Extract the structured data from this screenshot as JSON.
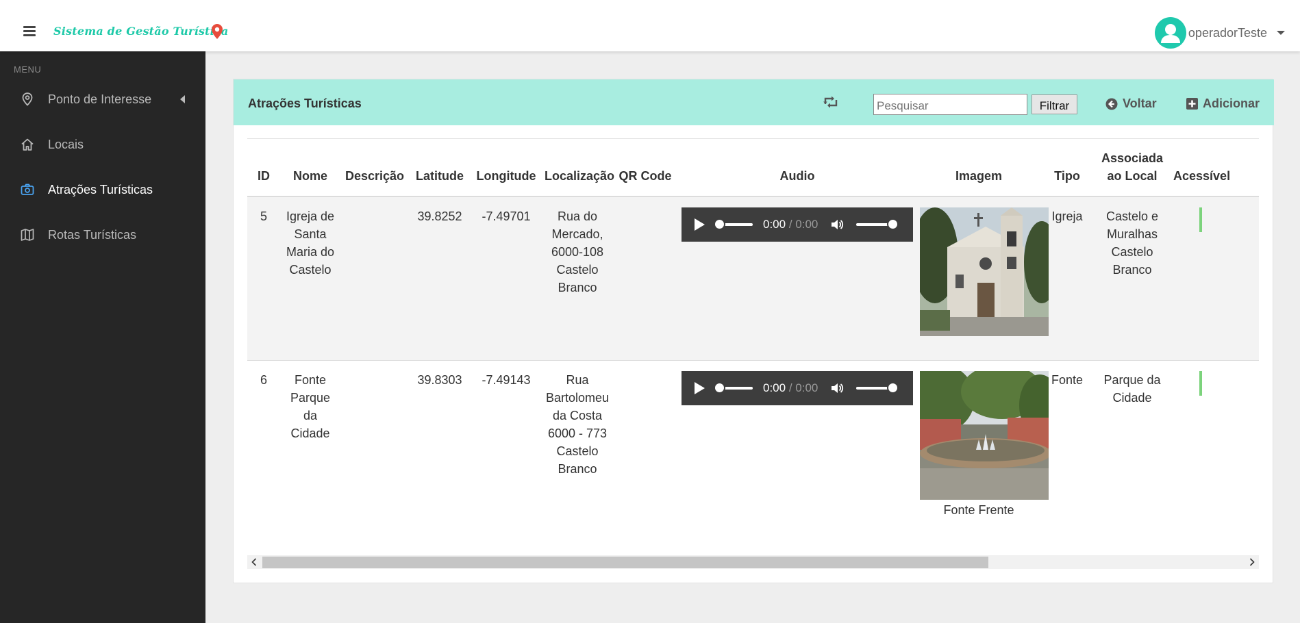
{
  "app": {
    "brand": "Sistema de Gestão Turística",
    "user": "operadorTeste"
  },
  "sidebar": {
    "heading": "MENU",
    "items": [
      {
        "label": "Ponto de Interesse",
        "icon": "map-pin-icon"
      },
      {
        "label": "Locais",
        "icon": "home-icon"
      },
      {
        "label": "Atrações Turísticas",
        "icon": "camera-icon"
      },
      {
        "label": "Rotas Turísticas",
        "icon": "map-icon"
      }
    ]
  },
  "panel": {
    "title": "Atrações Turísticas",
    "search_placeholder": "Pesquisar",
    "filter_label": "Filtrar",
    "back_label": "Voltar",
    "add_label": "Adicionar"
  },
  "table": {
    "columns": [
      "ID",
      "Nome",
      "Descrição",
      "Latitude",
      "Longitude",
      "Localização",
      "QR Code",
      "Audio",
      "Imagem",
      "Tipo",
      "Associada ao Local",
      "Acessível"
    ],
    "rows": [
      {
        "id": "5",
        "nome": "Igreja de Santa Maria do Castelo",
        "descricao": "",
        "latitude": "39.8252",
        "longitude": "-7.49701",
        "localizacao": "Rua do Mercado, 6000-108 Castelo Branco",
        "qr_code": "",
        "audio_current": "0:00",
        "audio_sep": " / ",
        "audio_duration": "0:00",
        "image_caption": "",
        "tipo": "Igreja",
        "local": "Castelo e Muralhas Castelo Branco"
      },
      {
        "id": "6",
        "nome": "Fonte Parque da Cidade",
        "descricao": "",
        "latitude": "39.8303",
        "longitude": "-7.49143",
        "localizacao": "Rua Bartolomeu da Costa 6000 - 773 Castelo Branco",
        "qr_code": "",
        "audio_current": "0:00",
        "audio_sep": " / ",
        "audio_duration": "0:00",
        "image_caption": "Fonte Frente",
        "tipo": "Fonte",
        "local": "Parque da Cidade"
      }
    ]
  },
  "colors": {
    "brand": "#1dc9a8",
    "header_bg": "#a8ede0",
    "sidebar_bg": "#262626",
    "active_icon": "#4aa3f0",
    "pin_red": "#e74c3c"
  }
}
